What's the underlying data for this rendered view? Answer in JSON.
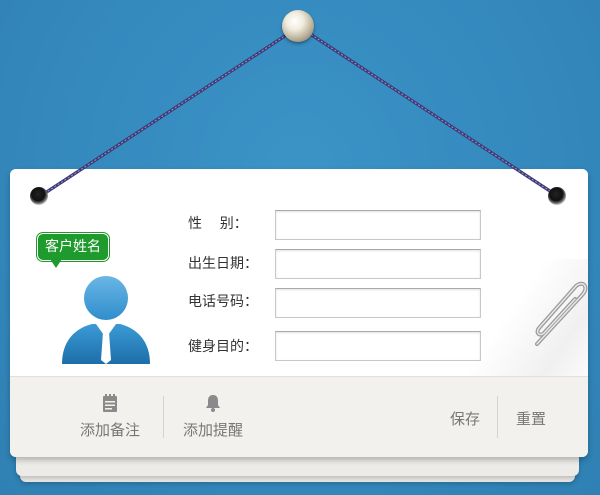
{
  "customer_badge": "客户姓名",
  "form": {
    "gender_label": "性    别：",
    "birth_label": "出生日期：",
    "phone_label": "电话号码：",
    "goal_label": "健身目的：",
    "gender_value": "",
    "birth_value": "",
    "phone_value": "",
    "goal_value": ""
  },
  "actions": {
    "add_note": "添加备注",
    "add_reminder": "添加提醒",
    "save": "保存",
    "reset": "重置"
  },
  "icons": {
    "note": "notepad-icon",
    "reminder": "bell-icon",
    "avatar": "person-avatar-icon",
    "clip": "paperclip-icon",
    "nail": "nail-icon"
  },
  "colors": {
    "background": "#3489bd",
    "badge": "#1f9a2c",
    "avatar": "#2f8ecb"
  }
}
